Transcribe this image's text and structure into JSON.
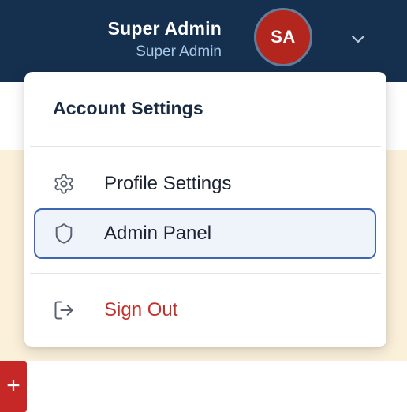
{
  "header": {
    "user_name": "Super Admin",
    "user_role": "Super Admin",
    "avatar_initials": "SA",
    "avatar_color": "#b3261e",
    "background_color": "#15304f"
  },
  "toolbar": {
    "add_button_label": "+"
  },
  "dropdown": {
    "title": "Account Settings",
    "items": [
      {
        "label": "Profile Settings",
        "icon": "gear-icon",
        "active": false
      },
      {
        "label": "Admin Panel",
        "icon": "shield-icon",
        "active": true
      },
      {
        "label": "Sign Out",
        "icon": "sign-out-icon",
        "color": "#c0322b"
      }
    ]
  }
}
